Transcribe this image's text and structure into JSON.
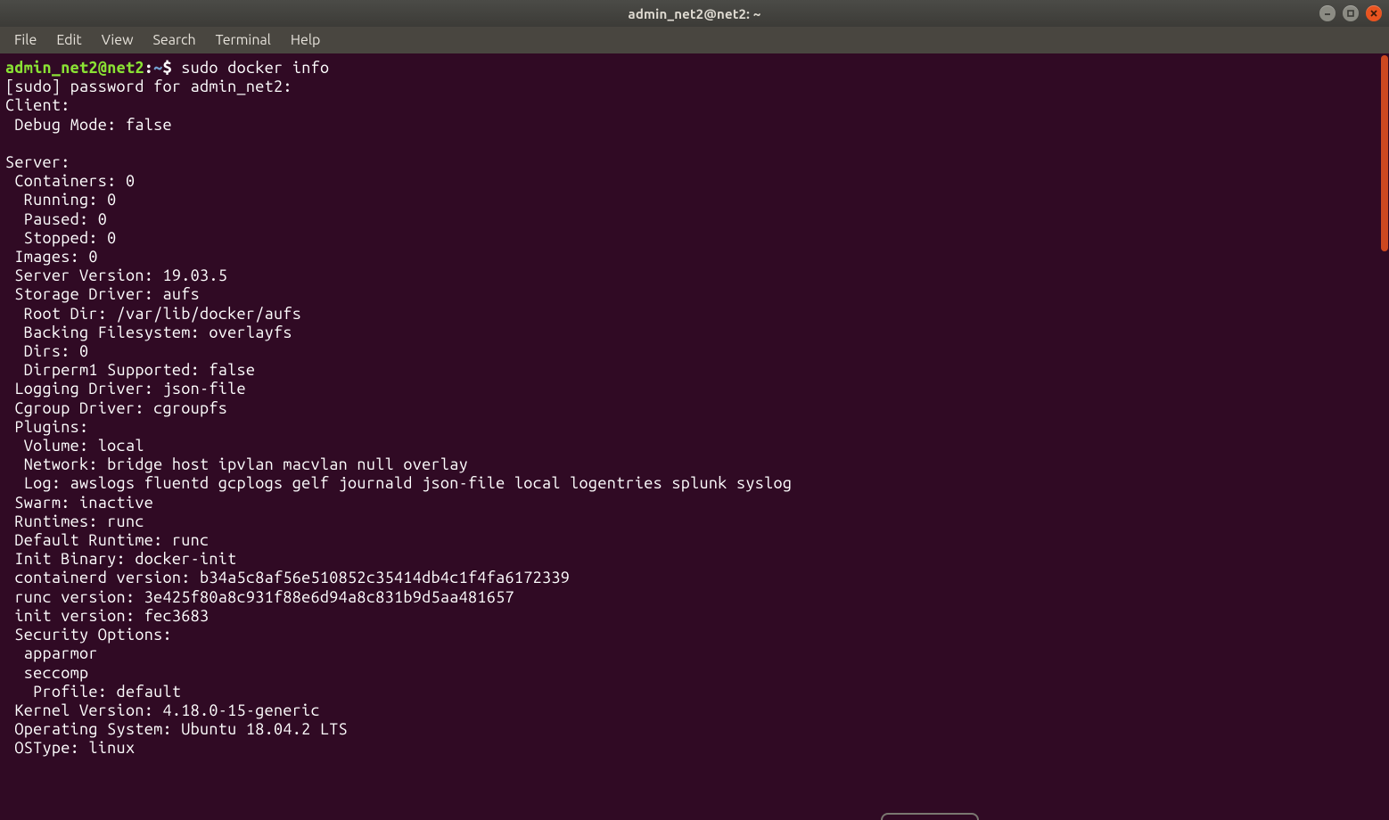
{
  "titlebar": {
    "title": "admin_net2@net2: ~"
  },
  "menubar": {
    "items": [
      "File",
      "Edit",
      "View",
      "Search",
      "Terminal",
      "Help"
    ]
  },
  "prompt": {
    "user": "admin_net2",
    "at": "@",
    "host": "net2",
    "colon": ":",
    "path": "~",
    "dollar": "$"
  },
  "command": "sudo docker info",
  "output_lines": [
    "[sudo] password for admin_net2:",
    "Client:",
    " Debug Mode: false",
    "",
    "Server:",
    " Containers: 0",
    "  Running: 0",
    "  Paused: 0",
    "  Stopped: 0",
    " Images: 0",
    " Server Version: 19.03.5",
    " Storage Driver: aufs",
    "  Root Dir: /var/lib/docker/aufs",
    "  Backing Filesystem: overlayfs",
    "  Dirs: 0",
    "  Dirperm1 Supported: false",
    " Logging Driver: json-file",
    " Cgroup Driver: cgroupfs",
    " Plugins:",
    "  Volume: local",
    "  Network: bridge host ipvlan macvlan null overlay",
    "  Log: awslogs fluentd gcplogs gelf journald json-file local logentries splunk syslog",
    " Swarm: inactive",
    " Runtimes: runc",
    " Default Runtime: runc",
    " Init Binary: docker-init",
    " containerd version: b34a5c8af56e510852c35414db4c1f4fa6172339",
    " runc version: 3e425f80a8c931f88e6d94a8c831b9d5aa481657",
    " init version: fec3683",
    " Security Options:",
    "  apparmor",
    "  seccomp",
    "   Profile: default",
    " Kernel Version: 4.18.0-15-generic",
    " Operating System: Ubuntu 18.04.2 LTS",
    " OSType: linux"
  ],
  "window_controls": {
    "minimize": "minimize",
    "maximize": "maximize",
    "close": "close"
  }
}
